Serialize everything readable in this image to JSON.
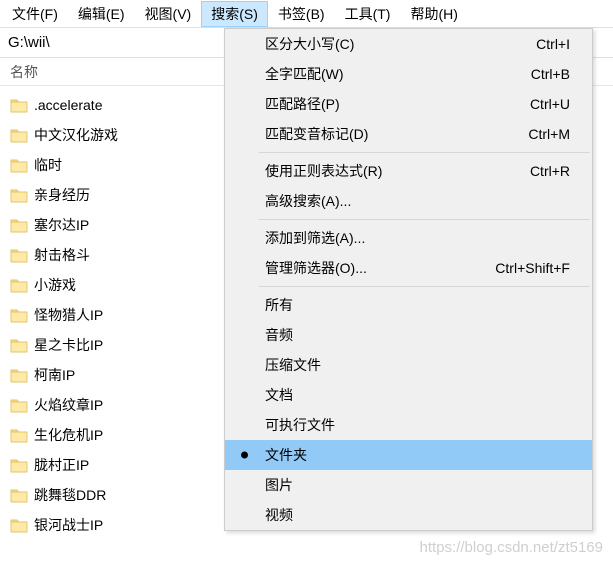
{
  "menubar": {
    "items": [
      {
        "label": "文件(F)"
      },
      {
        "label": "编辑(E)"
      },
      {
        "label": "视图(V)"
      },
      {
        "label": "搜索(S)"
      },
      {
        "label": "书签(B)"
      },
      {
        "label": "工具(T)"
      },
      {
        "label": "帮助(H)"
      }
    ],
    "activeIndex": 3
  },
  "path": {
    "value": "G:\\wii\\"
  },
  "columns": {
    "name": "名称"
  },
  "files": [
    {
      "name": ".accelerate"
    },
    {
      "name": "中文汉化游戏"
    },
    {
      "name": "临时"
    },
    {
      "name": "亲身经历"
    },
    {
      "name": "塞尔达IP"
    },
    {
      "name": "射击格斗"
    },
    {
      "name": "小游戏"
    },
    {
      "name": "怪物猎人IP"
    },
    {
      "name": "星之卡比IP"
    },
    {
      "name": "柯南IP"
    },
    {
      "name": "火焰纹章IP"
    },
    {
      "name": "生化危机IP"
    },
    {
      "name": "胧村正IP"
    },
    {
      "name": "跳舞毯DDR"
    },
    {
      "name": "银河战士IP"
    }
  ],
  "dropdown": {
    "groups": [
      [
        {
          "label": "区分大小写(C)",
          "shortcut": "Ctrl+I"
        },
        {
          "label": "全字匹配(W)",
          "shortcut": "Ctrl+B"
        },
        {
          "label": "匹配路径(P)",
          "shortcut": "Ctrl+U"
        },
        {
          "label": "匹配变音标记(D)",
          "shortcut": "Ctrl+M"
        }
      ],
      [
        {
          "label": "使用正则表达式(R)",
          "shortcut": "Ctrl+R"
        },
        {
          "label": "高级搜索(A)...",
          "shortcut": ""
        }
      ],
      [
        {
          "label": "添加到筛选(A)...",
          "shortcut": ""
        },
        {
          "label": "管理筛选器(O)...",
          "shortcut": "Ctrl+Shift+F"
        }
      ],
      [
        {
          "label": "所有",
          "shortcut": ""
        },
        {
          "label": "音频",
          "shortcut": ""
        },
        {
          "label": "压缩文件",
          "shortcut": ""
        },
        {
          "label": "文档",
          "shortcut": ""
        },
        {
          "label": "可执行文件",
          "shortcut": ""
        },
        {
          "label": "文件夹",
          "shortcut": "",
          "checked": true,
          "selected": true
        },
        {
          "label": "图片",
          "shortcut": ""
        },
        {
          "label": "视频",
          "shortcut": ""
        }
      ]
    ]
  },
  "watermark": "https://blog.csdn.net/zt5169"
}
